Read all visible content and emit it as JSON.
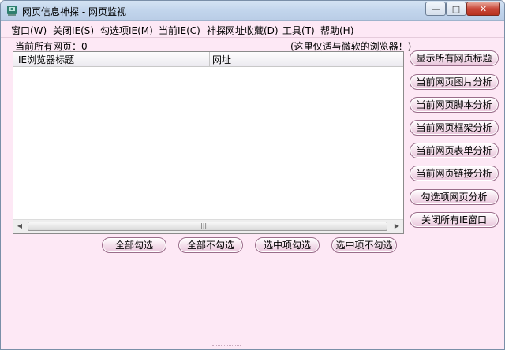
{
  "window": {
    "title": "网页信息神探 - 网页监视",
    "controls": {
      "minimize": "—",
      "maximize": "□",
      "close": "✕"
    }
  },
  "menu": [
    "窗口(W)",
    "关闭IE(S)",
    "勾选项IE(M)",
    "当前IE(C)",
    "神探网址收藏(D)",
    "工具(T)",
    "帮助(H)"
  ],
  "status": {
    "page_count": "当前所有网页：0",
    "note": "(这里仅适与微软的浏览器！)"
  },
  "list": {
    "columns": [
      "IE浏览器标题",
      "网址"
    ],
    "rows": [],
    "scroll_grip": "|||"
  },
  "right_buttons": [
    "显示所有网页标题",
    "当前网页图片分析",
    "当前网页脚本分析",
    "当前网页框架分析",
    "当前网页表单分析",
    "当前网页链接分析",
    "勾选项网页分析",
    "关闭所有IE窗口"
  ],
  "bottom_buttons": [
    "全部勾选",
    "全部不勾选",
    "选中项勾选",
    "选中项不勾选"
  ],
  "colors": {
    "background": "#fde8f5",
    "button_border": "#9a6d8a",
    "close_button": "#c9483a"
  },
  "icons": {
    "app": "detective-app-icon"
  }
}
